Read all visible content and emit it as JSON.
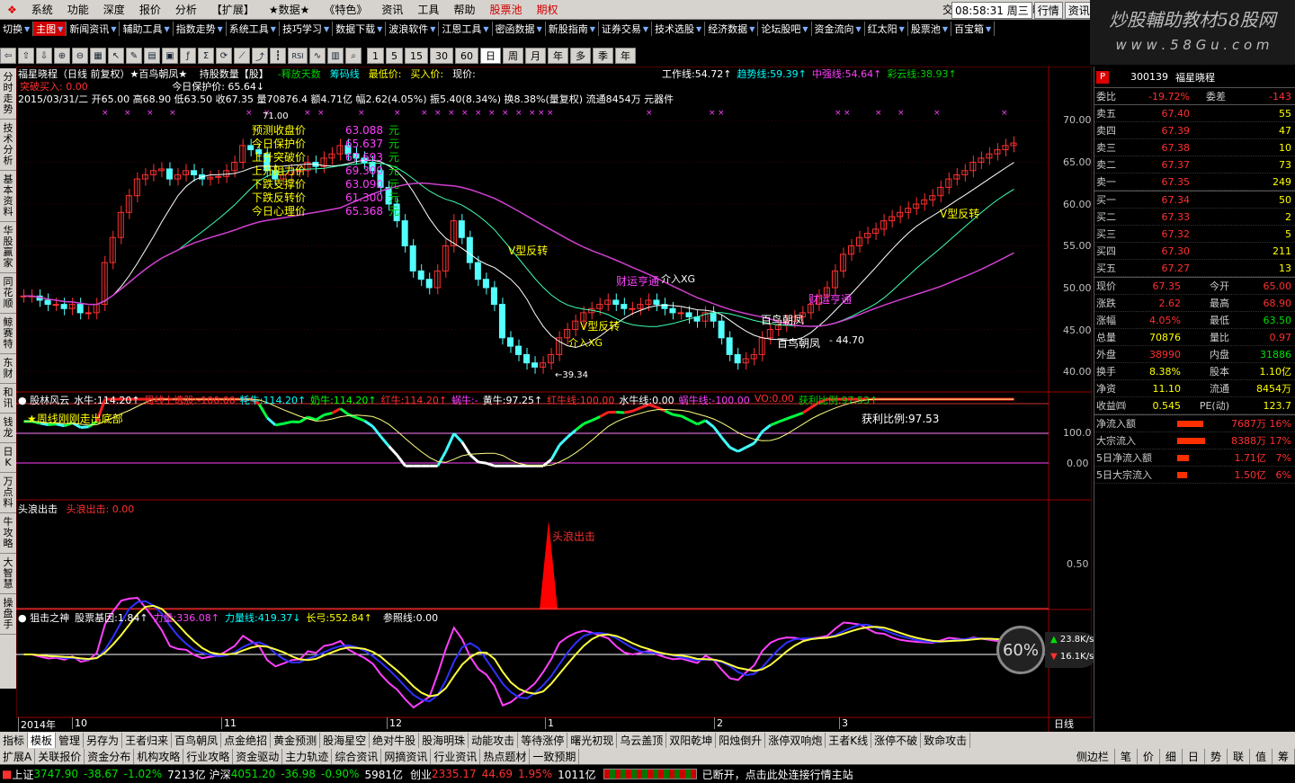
{
  "menu": {
    "items": [
      "系统",
      "功能",
      "深度",
      "报价",
      "分析",
      "【扩展】",
      "★数据★",
      "《特色》",
      "资讯",
      "工具",
      "帮助",
      "股票池",
      "期权"
    ],
    "login": "交易未登录",
    "stock": "福星晓程",
    "time": "08:58:31 周三",
    "btn_market": "行情",
    "btn_news": "资讯"
  },
  "banner": {
    "line1": "炒股輔助教材58股网",
    "line2": "w w w . 5 8 G u . c o m"
  },
  "nav": [
    "切换",
    "主图",
    "新闻资讯",
    "辅助工具",
    "指数走势",
    "系统工具",
    "技巧学习",
    "数据下载",
    "波浪软件",
    "江恩工具",
    "密函数据",
    "新股指南",
    "证券交易",
    "技术选股",
    "经济数据",
    "论坛股吧",
    "资金流向",
    "红太阳",
    "股票池",
    "百宝箱"
  ],
  "toolbar": {
    "periods": [
      "1",
      "5",
      "15",
      "30",
      "60",
      "日",
      "周",
      "月",
      "年",
      "多",
      "季",
      "年"
    ],
    "active": "日"
  },
  "leftstrip": [
    "分时走势",
    "技术分析",
    "基本资料",
    "华股赢家",
    "同花顺",
    "鲸赛特",
    "东财",
    "和讯",
    "钱龙",
    "日K",
    "万点料",
    "牛攻略",
    "大智慧",
    "操盘手"
  ],
  "main": {
    "title": "福星晓程（日线 前复权）★百鸟朝凤★",
    "title_extra": [
      "持股数量【股】",
      "-释放天数",
      "筹码线",
      "最低价:",
      "买入价:",
      "现价:"
    ],
    "indic": [
      {
        "t": "工作线:",
        "v": "54.72↑",
        "c": "#fff"
      },
      {
        "t": "趋势线:",
        "v": "59.39↑",
        "c": "#00ffff"
      },
      {
        "t": "中强线:",
        "v": "54.64↑",
        "c": "#ff40ff"
      },
      {
        "t": "彩云线:",
        "v": "38.93↑",
        "c": "#00d000"
      }
    ],
    "line2a": "突破买入: 0.00",
    "line2b": "今日保护价: 65.64↓",
    "line3": "2015/03/31/二 开65.00 高68.90 低63.50 收67.35 量70876.4 额4.71亿 幅2.62(4.05%) 振5.40(8.34%) 换8.38%(量复权) 流通8454万 元器件",
    "box": [
      [
        "预测收盘价",
        "63.088",
        "元"
      ],
      [
        "今日保护价",
        "65.637",
        "元"
      ],
      [
        "上升突破价",
        "67.693",
        "元"
      ],
      [
        "上升阻力价",
        "69.300",
        "元"
      ],
      [
        "下跌支撑价",
        "63.090",
        "元"
      ],
      [
        "下跌反转价",
        "61.300",
        "元"
      ],
      [
        "今日心理价",
        "65.368",
        "元"
      ]
    ],
    "ann": {
      "hi": "71.00",
      "lo": "←39.34",
      "v1": "V型反转",
      "v2": "V型反转",
      "v3": "V型反转",
      "cs": "财运亨通",
      "cs2": "财运亨通",
      "jr": "介入XG",
      "jr2": "介入XG",
      "bn": "百鸟朝凤",
      "bn2": "百鸟朝凤",
      "val": "- 44.70"
    }
  },
  "sub1": {
    "name": "股林风云",
    "items": [
      {
        "t": "水牛:",
        "v": "114.20↑",
        "c": "#fff"
      },
      {
        "t": "周线上选股:",
        "v": "-100.00",
        "c": "#ff3030"
      },
      {
        "t": "牦牛:",
        "v": "114.20↑",
        "c": "#00ffff"
      },
      {
        "t": "奶牛:",
        "v": "114.20↑",
        "c": "#00ff00"
      },
      {
        "t": "红牛:",
        "v": "114.20↑",
        "c": "#ff3030"
      },
      {
        "t": "蜗牛:",
        "v": "-",
        "c": "#ff40ff"
      },
      {
        "t": "黄牛:",
        "v": "97.25↑",
        "c": "#fff"
      },
      {
        "t": "红牛线:",
        "v": "100.00",
        "c": "#ff3030"
      },
      {
        "t": "水牛线:",
        "v": "0.00",
        "c": "#fff"
      },
      {
        "t": "蜗牛线:",
        "v": "-100.00",
        "c": "#ff40ff"
      },
      {
        "t": "VO:",
        "v": "0.00",
        "c": "#ff3030"
      },
      {
        "t": "获利比例:",
        "v": "97.53↑",
        "c": "#00d000"
      }
    ],
    "star": "★周线刚刚走出底部",
    "profit": "获利比例:97.53"
  },
  "sub2": {
    "name": "头浪出击",
    "v": "头浪出击: 0.00",
    "lbl": "头浪出击"
  },
  "sub3": {
    "name": "狙击之神",
    "items": [
      {
        "t": "股票基因:",
        "v": "1.84↑",
        "c": "#fff"
      },
      {
        "t": "力量:",
        "v": "336.08↑",
        "c": "#ff40ff"
      },
      {
        "t": "力量线:",
        "v": "419.37↓",
        "c": "#00ffff"
      },
      {
        "t": "长弓:",
        "v": "552.84↑",
        "c": "#ffff00"
      },
      {
        "t": "",
        "v": "",
        "c": "#5050ff"
      },
      {
        "t": "参照线:",
        "v": "0.00",
        "c": "#fff"
      }
    ]
  },
  "axis": {
    "main": [
      "70.00",
      "65.00",
      "60.00",
      "55.00",
      "50.00",
      "45.00",
      "40.00"
    ],
    "sub1": [
      "100.0",
      "0.00"
    ],
    "sub2": [
      "0.50"
    ],
    "dates": [
      "2014年",
      "10",
      "11",
      "12",
      "1",
      "2",
      "3"
    ],
    "period": "日线"
  },
  "gauge": {
    "pct": "60%",
    "up": "23.8K/s",
    "dn": "16.1K/s"
  },
  "quote": {
    "code": "300139",
    "name": "福星晓程",
    "wb": {
      "t": "委比",
      "v": "-19.72%",
      "t2": "委差",
      "v2": "-143"
    },
    "sell": [
      [
        "卖五",
        "67.40",
        "55"
      ],
      [
        "卖四",
        "67.39",
        "47"
      ],
      [
        "卖三",
        "67.38",
        "10"
      ],
      [
        "卖二",
        "67.37",
        "73"
      ],
      [
        "卖一",
        "67.35",
        "249"
      ]
    ],
    "buy": [
      [
        "买一",
        "67.34",
        "50"
      ],
      [
        "买二",
        "67.33",
        "2"
      ],
      [
        "买三",
        "67.32",
        "5"
      ],
      [
        "买四",
        "67.30",
        "211"
      ],
      [
        "买五",
        "67.27",
        "13"
      ]
    ],
    "info": [
      [
        "现价",
        "67.35",
        "今开",
        "65.00"
      ],
      [
        "涨跌",
        "2.62",
        "最高",
        "68.90"
      ],
      [
        "涨幅",
        "4.05%",
        "最低",
        "63.50"
      ],
      [
        "总量",
        "70876",
        "量比",
        "0.97"
      ],
      [
        "外盘",
        "38990",
        "内盘",
        "31886"
      ],
      [
        "换手",
        "8.38%",
        "股本",
        "1.10亿"
      ],
      [
        "净资",
        "11.10",
        "流通",
        "8454万"
      ],
      [
        "收益㈣",
        "0.545",
        "PE(动)",
        "123.7"
      ]
    ],
    "flow": [
      [
        "净流入额",
        "7687万",
        "16%",
        0.16
      ],
      [
        "大宗流入",
        "8388万",
        "17%",
        0.17
      ],
      [
        "5日净流入额",
        "1.71亿",
        "7%",
        0.07
      ],
      [
        "5日大宗流入",
        "1.50亿",
        "6%",
        0.06
      ]
    ]
  },
  "tabs1": [
    "指标",
    "模板",
    "管理",
    "另存为",
    "王者归来",
    "百鸟朝凤",
    "点金绝招",
    "黄金预测",
    "股海星空",
    "绝对牛股",
    "股海明珠",
    "动能攻击",
    "等待涨停",
    "曙光初现",
    "乌云盖顶",
    "双阳乾坤",
    "阳烛倒升",
    "涨停双响炮",
    "王者K线",
    "涨停不破",
    "致命攻击"
  ],
  "tabs2": [
    "扩展A",
    "关联报价",
    "资金分布",
    "机构攻略",
    "行业攻略",
    "资金驱动",
    "主力轨迹",
    "综合资讯",
    "网摘资讯",
    "行业资讯",
    "热点题材",
    "一致预期"
  ],
  "rtabs": [
    "侧边栏",
    "笔",
    "价",
    "细",
    "日",
    "势",
    "联",
    "值",
    "筹"
  ],
  "status": {
    "sh": "上证",
    "shv": "3747.90",
    "shc": "-38.67",
    "shp": "-1.02%",
    "sha": "7213亿",
    "hs": "沪深",
    "hsv": "4051.20",
    "hsc": "-36.98",
    "hsp": "-0.90%",
    "hsa": "5981亿",
    "cy": "创业",
    "cyv": "2335.17",
    "cyc": "44.69",
    "cyp": "1.95%",
    "cya": "1011亿",
    "msg": "已断开，点击此处连接行情主站"
  }
}
